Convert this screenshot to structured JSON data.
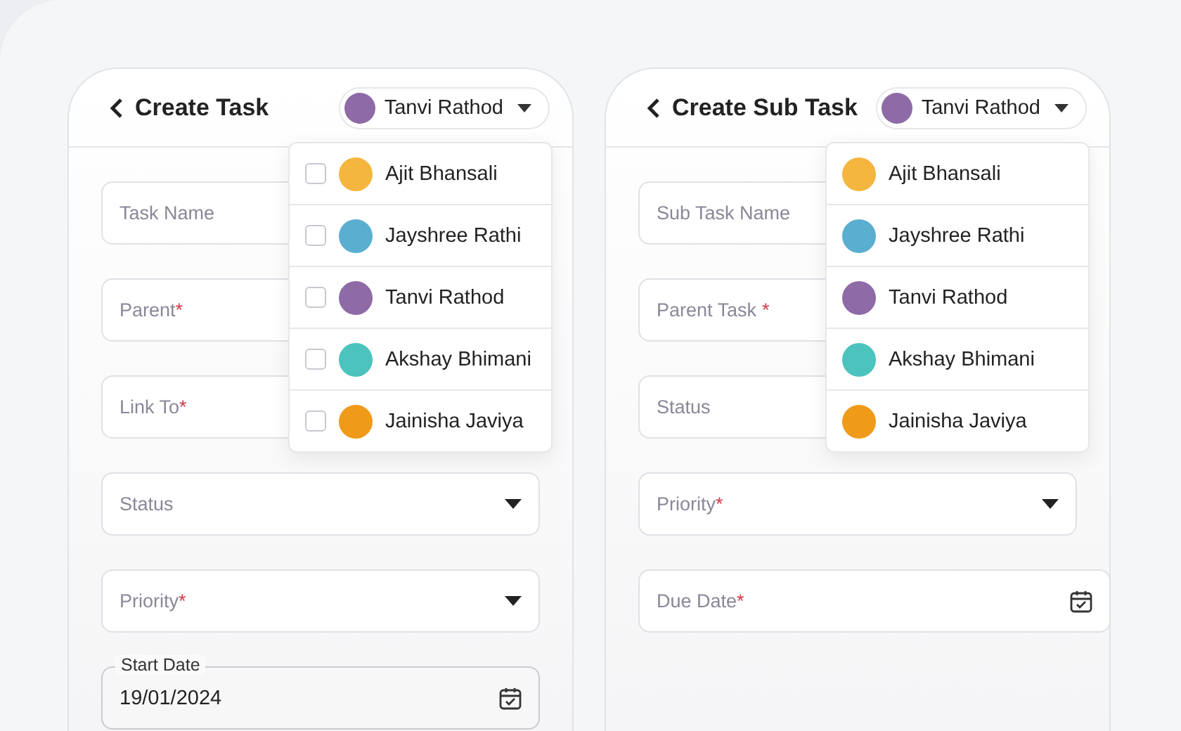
{
  "panels": [
    {
      "title": "Create Task",
      "user": {
        "name": "Tanvi Rathod",
        "color": "#8e6aa6"
      },
      "fields": [
        {
          "kind": "text",
          "placeholder": "Task Name"
        },
        {
          "kind": "text",
          "placeholder": "Parent",
          "required_mark": "*"
        },
        {
          "kind": "text",
          "placeholder": "Link To",
          "required_mark": "*"
        },
        {
          "kind": "select",
          "placeholder": "Status"
        },
        {
          "kind": "select",
          "placeholder": "Priority",
          "required_mark": "*"
        },
        {
          "kind": "date",
          "label": "Start Date",
          "value": "19/01/2024"
        }
      ],
      "menu": [
        {
          "name": "Ajit Bhansali",
          "color": "#f4b63f",
          "checked": false
        },
        {
          "name": "Jayshree Rathi",
          "color": "#5aaed0",
          "checked": false
        },
        {
          "name": "Tanvi Rathod",
          "color": "#8e6aa6",
          "checked": false
        },
        {
          "name": "Akshay Bhimani",
          "color": "#4cc3bd",
          "checked": false
        },
        {
          "name": "Jainisha Javiya",
          "color": "#f09a1a",
          "checked": false
        }
      ]
    },
    {
      "title": "Create Sub Task",
      "user": {
        "name": "Tanvi Rathod",
        "color": "#8e6aa6"
      },
      "fields": [
        {
          "kind": "text",
          "placeholder": "Sub Task Name"
        },
        {
          "kind": "text",
          "placeholder": "Parent Task",
          "required_mark": "*"
        },
        {
          "kind": "text",
          "placeholder": "Status"
        },
        {
          "kind": "select",
          "placeholder": "Priority",
          "required_mark": "*"
        },
        {
          "kind": "date",
          "placeholder": "Due Date",
          "required_mark": "*"
        }
      ],
      "menu": [
        {
          "name": "Ajit Bhansali",
          "color": "#f4b63f"
        },
        {
          "name": "Jayshree Rathi",
          "color": "#5aaed0"
        },
        {
          "name": "Tanvi Rathod",
          "color": "#8e6aa6"
        },
        {
          "name": "Akshay Bhimani",
          "color": "#4cc3bd"
        },
        {
          "name": "Jainisha Javiya",
          "color": "#f09a1a"
        }
      ]
    }
  ]
}
